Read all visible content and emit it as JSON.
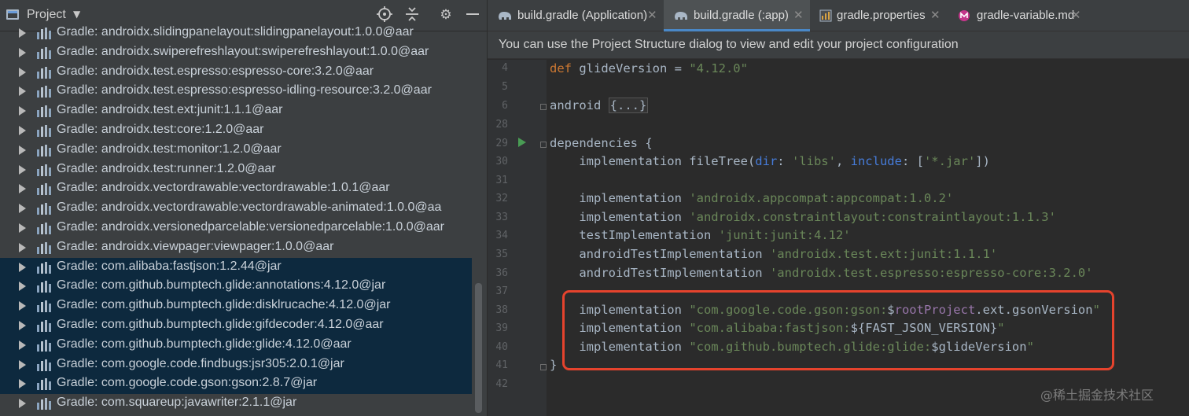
{
  "project_panel": {
    "title": "Project",
    "icons": [
      "target-icon",
      "collapse-all-icon",
      "gear-icon",
      "minimize-icon"
    ],
    "tree_items": [
      {
        "label": "Gradle: androidx.slidingpanelayout:slidingpanelayout:1.0.0@aar",
        "selected": false
      },
      {
        "label": "Gradle: androidx.swiperefreshlayout:swiperefreshlayout:1.0.0@aar",
        "selected": false
      },
      {
        "label": "Gradle: androidx.test.espresso:espresso-core:3.2.0@aar",
        "selected": false
      },
      {
        "label": "Gradle: androidx.test.espresso:espresso-idling-resource:3.2.0@aar",
        "selected": false
      },
      {
        "label": "Gradle: androidx.test.ext:junit:1.1.1@aar",
        "selected": false
      },
      {
        "label": "Gradle: androidx.test:core:1.2.0@aar",
        "selected": false
      },
      {
        "label": "Gradle: androidx.test:monitor:1.2.0@aar",
        "selected": false
      },
      {
        "label": "Gradle: androidx.test:runner:1.2.0@aar",
        "selected": false
      },
      {
        "label": "Gradle: androidx.vectordrawable:vectordrawable:1.0.1@aar",
        "selected": false
      },
      {
        "label": "Gradle: androidx.vectordrawable:vectordrawable-animated:1.0.0@aa",
        "selected": false
      },
      {
        "label": "Gradle: androidx.versionedparcelable:versionedparcelable:1.0.0@aar",
        "selected": false
      },
      {
        "label": "Gradle: androidx.viewpager:viewpager:1.0.0@aar",
        "selected": false
      },
      {
        "label": "Gradle: com.alibaba:fastjson:1.2.44@jar",
        "selected": true
      },
      {
        "label": "Gradle: com.github.bumptech.glide:annotations:4.12.0@jar",
        "selected": true
      },
      {
        "label": "Gradle: com.github.bumptech.glide:disklrucache:4.12.0@jar",
        "selected": true
      },
      {
        "label": "Gradle: com.github.bumptech.glide:gifdecoder:4.12.0@aar",
        "selected": true
      },
      {
        "label": "Gradle: com.github.bumptech.glide:glide:4.12.0@aar",
        "selected": true
      },
      {
        "label": "Gradle: com.google.code.findbugs:jsr305:2.0.1@jar",
        "selected": true
      },
      {
        "label": "Gradle: com.google.code.gson:gson:2.8.7@jar",
        "selected": true
      },
      {
        "label": "Gradle: com.squareup:javawriter:2.1.1@jar",
        "selected": false
      }
    ]
  },
  "tabs": [
    {
      "label": "build.gradle (Application)",
      "active": false,
      "icon": "gradle-elephant-icon"
    },
    {
      "label": "build.gradle (:app)",
      "active": true,
      "icon": "gradle-elephant-icon"
    },
    {
      "label": "gradle.properties",
      "active": false,
      "icon": "properties-file-icon"
    },
    {
      "label": "gradle-variable.md",
      "active": false,
      "icon": "markdown-file-icon"
    }
  ],
  "notice": "You can use the Project Structure dialog to view and edit your project configuration",
  "line_numbers": [
    "4",
    "5",
    "6",
    "28",
    "29",
    "30",
    "31",
    "32",
    "33",
    "34",
    "35",
    "36",
    "37",
    "38",
    "39",
    "40",
    "41",
    "42"
  ],
  "code": {
    "l4": {
      "kw": "def",
      "rest": " glideVersion = ",
      "str": "\"4.12.0\""
    },
    "l6": {
      "text": "android ",
      "fold": "{...}"
    },
    "l29": {
      "text": "dependencies {"
    },
    "l30": {
      "a": "    implementation fileTree(",
      "b": "dir",
      "c": ": ",
      "d": "'libs'",
      "e": ", ",
      "f": "include",
      "g": ": [",
      "h": "'*.jar'",
      "i": "])"
    },
    "l32": {
      "a": "    implementation ",
      "s": "'androidx.appcompat:appcompat:1.0.2'"
    },
    "l33": {
      "a": "    implementation ",
      "s": "'androidx.constraintlayout:constraintlayout:1.1.3'"
    },
    "l34": {
      "a": "    testImplementation ",
      "s": "'junit:junit:4.12'"
    },
    "l35": {
      "a": "    androidTestImplementation ",
      "s": "'androidx.test.ext:junit:1.1.1'"
    },
    "l36": {
      "a": "    androidTestImplementation ",
      "s": "'androidx.test.espresso:espresso-core:3.2.0'"
    },
    "l38": {
      "a": "    implementation ",
      "s1": "\"com.google.code.gson:gson:",
      "v1": "$",
      "v2": "rootProject",
      "v3": ".ext.gsonVersion",
      "s2": "\""
    },
    "l39": {
      "a": "    implementation ",
      "s1": "\"com.alibaba:fastjson:",
      "v": "${FAST_JSON_VERSION}",
      "s2": "\""
    },
    "l40": {
      "a": "    implementation ",
      "s1": "\"com.github.bumptech.glide:glide:",
      "v": "$glideVersion",
      "s2": "\""
    },
    "l41": {
      "text": "}"
    }
  },
  "watermark": "@稀土掘金技术社区",
  "colors": {
    "keyword": "#cc7832",
    "string": "#6a8759",
    "named_arg": "#467cda",
    "field": "#9876aa",
    "highlight_box": "#e5432d",
    "selection": "#0d293e"
  }
}
